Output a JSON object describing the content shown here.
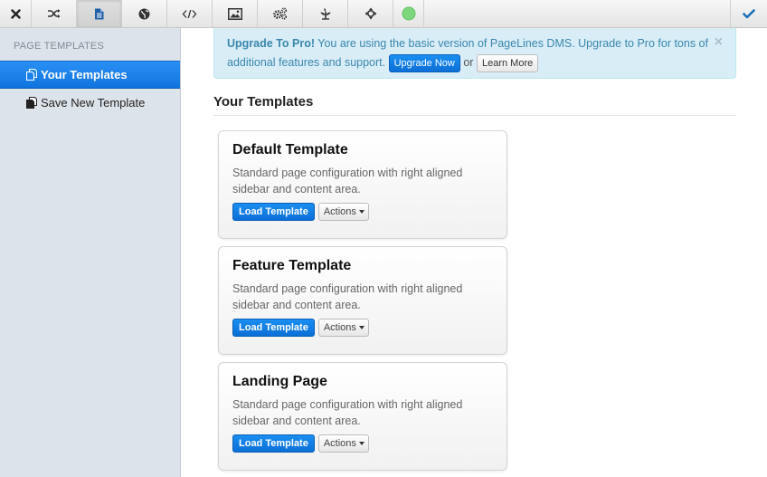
{
  "toolbar": {
    "items": [
      {
        "name": "close-icon"
      },
      {
        "name": "shuffle-icon"
      },
      {
        "name": "document-icon"
      },
      {
        "name": "globe-icon"
      },
      {
        "name": "code-icon"
      },
      {
        "name": "image-icon"
      },
      {
        "name": "gears-icon"
      },
      {
        "name": "leaf-icon"
      },
      {
        "name": "move-icon"
      },
      {
        "name": "status-dot-icon",
        "color": "#7dd87d"
      }
    ],
    "publish_icon": "checkmark-icon"
  },
  "sidebar": {
    "heading": "PAGE TEMPLATES",
    "items": [
      {
        "label": "Your Templates",
        "icon": "templates-icon",
        "active": true
      },
      {
        "label": "Save New Template",
        "icon": "save-template-icon",
        "active": false
      }
    ]
  },
  "alert": {
    "title": "Upgrade To Pro!",
    "message": "You are using the basic version of PageLines DMS. Upgrade to Pro for tons of additional features and support.",
    "upgrade_label": "Upgrade Now",
    "or": "or",
    "learn_label": "Learn More",
    "close": "×"
  },
  "main": {
    "section_title": "Your Templates",
    "templates": [
      {
        "title": "Default Template",
        "description": "Standard page configuration with right aligned sidebar and content area.",
        "load_label": "Load Template",
        "actions_label": "Actions"
      },
      {
        "title": "Feature Template",
        "description": "Standard page configuration with right aligned sidebar and content area.",
        "load_label": "Load Template",
        "actions_label": "Actions"
      },
      {
        "title": "Landing Page",
        "description": "Standard page configuration with right aligned sidebar and content area.",
        "load_label": "Load Template",
        "actions_label": "Actions"
      }
    ]
  },
  "colors": {
    "accent": "#1a7fe6",
    "alert_bg": "#d9edf7",
    "alert_text": "#3a87ad",
    "sidebar_bg": "#dde3ea"
  }
}
